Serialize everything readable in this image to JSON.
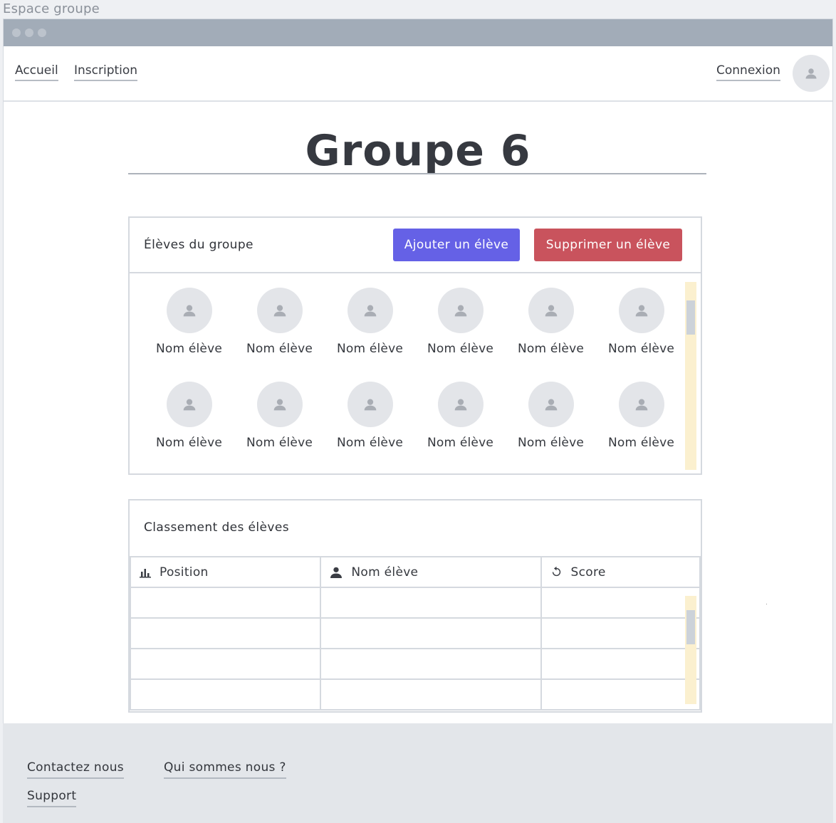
{
  "window": {
    "title": "Espace groupe"
  },
  "nav": {
    "links": [
      "Accueil",
      "Inscription"
    ],
    "login": "Connexion"
  },
  "page": {
    "title": "Groupe 6"
  },
  "students_card": {
    "title": "Élèves du groupe",
    "add_button": "Ajouter un élève",
    "delete_button": "Supprimer un élève",
    "students": [
      "Nom élève",
      "Nom élève",
      "Nom élève",
      "Nom élève",
      "Nom élève",
      "Nom élève",
      "Nom élève",
      "Nom élève",
      "Nom élève",
      "Nom élève",
      "Nom élève",
      "Nom élève"
    ]
  },
  "ranking_card": {
    "title": "Classement des élèves",
    "columns": [
      {
        "label": "Position",
        "icon": "bar-chart-icon"
      },
      {
        "label": "Nom élève",
        "icon": "person-icon"
      },
      {
        "label": "Score",
        "icon": "refresh-icon"
      }
    ],
    "rows": [
      [
        "",
        "",
        ""
      ],
      [
        "",
        "",
        ""
      ],
      [
        "",
        "",
        ""
      ],
      [
        "",
        "",
        ""
      ]
    ]
  },
  "footer": {
    "links": [
      "Contactez nous",
      "Qui sommes nous ?",
      "Support"
    ]
  },
  "colors": {
    "accent_add": "#6561e6",
    "accent_delete": "#c9535d",
    "titlebar": "#a2acb8",
    "scroll_track": "#fbf0cf"
  }
}
